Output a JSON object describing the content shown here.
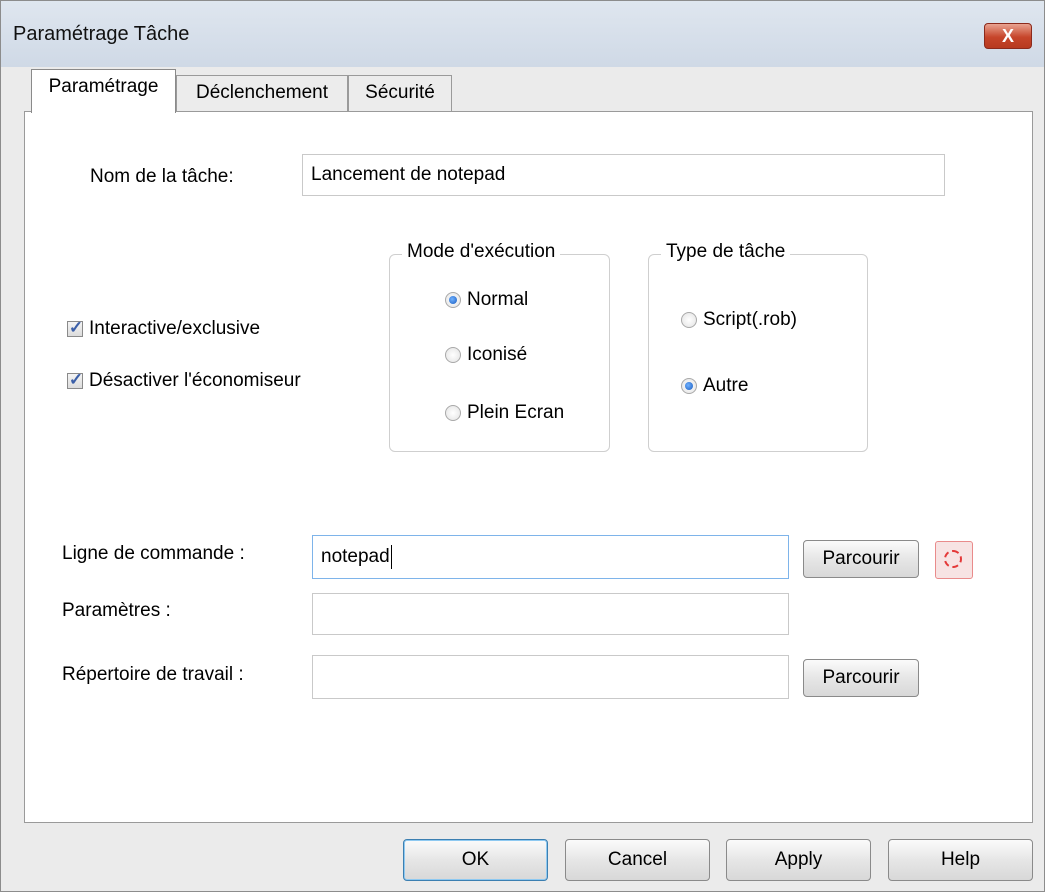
{
  "window": {
    "title": "Paramétrage Tâche",
    "close_label": "X"
  },
  "tabs": [
    {
      "label": "Paramétrage",
      "active": true
    },
    {
      "label": "Déclenchement",
      "active": false
    },
    {
      "label": "Sécurité",
      "active": false
    }
  ],
  "task_name": {
    "label": "Nom de la tâche:",
    "value": "Lancement de notepad"
  },
  "options": {
    "interactive": {
      "label": "Interactive/exclusive",
      "checked": true
    },
    "disable_screensaver": {
      "label": "Désactiver l'économiseur",
      "checked": true
    }
  },
  "execution_mode": {
    "title": "Mode d'exécution",
    "options": [
      {
        "label": "Normal",
        "selected": true
      },
      {
        "label": "Iconisé",
        "selected": false
      },
      {
        "label": "Plein Ecran",
        "selected": false
      }
    ]
  },
  "task_type": {
    "title": "Type de tâche",
    "options": [
      {
        "label": "Script(.rob)",
        "selected": false
      },
      {
        "label": "Autre",
        "selected": true
      }
    ]
  },
  "command_line": {
    "label": "Ligne de commande :",
    "value": "notepad",
    "browse_label": "Parcourir"
  },
  "parameters": {
    "label": "Paramètres :",
    "value": ""
  },
  "working_dir": {
    "label": "Répertoire de travail :",
    "value": "",
    "browse_label": "Parcourir"
  },
  "footer": {
    "ok": "OK",
    "cancel": "Cancel",
    "apply": "Apply",
    "help": "Help"
  },
  "colors": {
    "titlebar": "#d6dfea",
    "close": "#c6452a",
    "focus_border": "#7eb4ea",
    "radio_dot": "#1a5cbf"
  }
}
